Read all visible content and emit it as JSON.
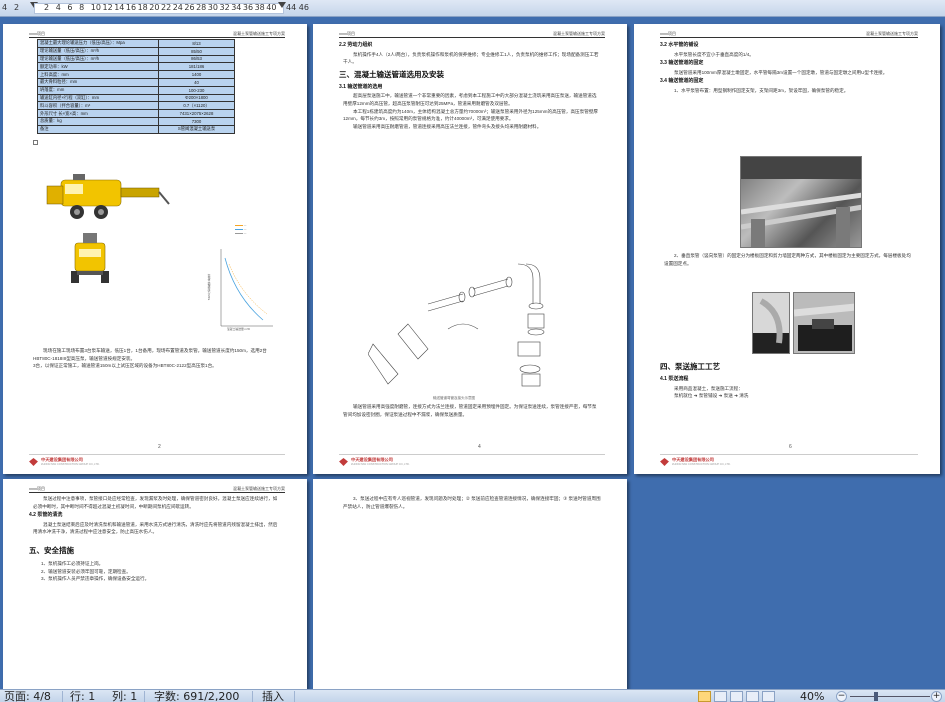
{
  "ruler": {
    "left_labels": [
      "4",
      "2"
    ],
    "labels": [
      "2",
      "4",
      "6",
      "8",
      "10",
      "12",
      "14",
      "16",
      "18",
      "20",
      "22",
      "24",
      "26",
      "28",
      "30",
      "32",
      "34",
      "36",
      "38",
      "40"
    ],
    "right_label": "44 46"
  },
  "doc": {
    "header_left": "xxxx项目",
    "header_right": "混凝土泵管输送施工专项方案",
    "company": "中天建设集团有限公司",
    "company_en": "ZHONGTIAN CONSTRUCTION GROUP CO.,LTD.",
    "pages": {
      "p2": {
        "number": "2",
        "table": [
          [
            "混凝土最大理论输送压力（低压/高压）：Mpa",
            "8/13"
          ],
          [
            "理论输送量（低压/高压）：m³/h",
            "85/50"
          ],
          [
            "理论输送量（低压/高压）：m³/h",
            "86/53"
          ],
          [
            "额定功率：kW",
            "181/186"
          ],
          [
            "上料高度：mm",
            "1400"
          ],
          [
            "最大骨料粒径：mm",
            "40"
          ],
          [
            "坍落度：mm",
            "100-230"
          ],
          [
            "输送缸内径×行程（双缸）：mm",
            "Φ200×1800"
          ],
          [
            "料斗容积（拌合容量）：m³",
            "0.7（×1120）"
          ],
          [
            "外形尺寸 长×宽×高：mm",
            "7431×2075×2628"
          ],
          [
            "总质量：kg",
            "7300"
          ],
          [
            "备注",
            "S管阀混凝土输送泵"
          ]
        ],
        "chart_labels": [
          "混凝土输送量 m³/h",
          "混凝土输送压力 MPa"
        ],
        "text": "现场在施工现场布置3台泵车输送，低压1台，1台备用，现场布置管道及泵管。输送管道长度约150m，选用2台HBT80C-1818III型高压泵，输送管道按规定安装。",
        "text2": "3台，以保证正常施工，输送管道150m以上试压区域的设备为HBT80C-2122型高压泵1台。"
      },
      "p4": {
        "number": "4",
        "s1_title": "2.2 劳动力组织",
        "s1_text": "泵机操作手4人（2人/两台），负责泵机操作和泵机的保养维修；专业维修工1人，负责泵机的维修工作；现场配备测压工若干人。",
        "s2_title": "三、混凝土输送管道选用及安装",
        "s3_title": "3.1 输送管道的选用",
        "s3_text": "超高层泵送施工中，输送管道一个非常重要的因素，考虑到本工程施工中的大部分混凝土浇筑采用高压泵送，输送管道选用壁厚12mm的高压管，超高压泵管耐压可达到25MPa，管道采用耐磨管及双层管。",
        "s3_text2": "本工程1栋建筑高度约为140m，主体结构混凝土总方量约70000m³；输送泵管采用外径为125mm的高压管，高压泵管壁厚12mm，每节长约3m，按照常用的泵管规格为准，约计40000m³，可满足使用要求。",
        "s3_text3": "输送管道采用高压耐磨管道，管道连接采用高压法兰连接，管件弯头及接头均采用耐磨材料。",
        "pipe_caption": "输送管道弯管及接头示意图",
        "s4_text": "输送管道采用高强度耐磨管，连接方式为法兰连接，管道固定采用预埋件固定。为保证泵送连续，泵管连接严密，每节泵管间均加设密封圈，保证泵送过程中不漏浆，确保泵送质量。"
      },
      "p6": {
        "number": "6",
        "s1_title": "3.2 水平管的铺设",
        "s1_text": "水平泵管长度不宜小于垂直高度的1/4。",
        "s2_title": "3.3 输送管道的固定",
        "s2_text": "泵送管道采用100mm厚混凝土墩固定，水平管每隔3m设置一个固定墩，管道与固定墩之间用U型卡连接。",
        "s3_title": "3.4 输送管道的固定",
        "s3_text": "1、水平泵管布置：用型钢制作固定支架，支架间距3m，架设牢固，确保泵管的稳定。",
        "s3_text2": "2、垂直泵管（竖向泵管）的固定分为楼板固定和剪力墙固定两种方式，其中楼板固定为主要固定方式，每层楼板处均设置固定点。",
        "s4_title": "四、泵送施工工艺",
        "s5_title": "4.1 泵送流程",
        "s5_text": "采用商品混凝土，泵送施工流程：",
        "flow": [
          "泵机就位",
          "泵管铺设",
          "泵送",
          "清洗"
        ]
      },
      "p7": {
        "p1": "泵送过程中注意事项，泵管接口处应经常检查，发现漏浆及时处理，确保管道密封良好。混凝土泵送应连续进行，如必须中断时，其中断时间不得超过混凝土初凝时间，中断期间泵机应间歇运转。",
        "s1_title": "4.2 泵管的清洗",
        "s1_text": "混凝土泵送结束后应及时清洗泵机和输送管道，采用水洗方式进行清洗，清洗时应先将管道内残留混凝土排出，然后用清水冲洗干净，清洗过程中应注意安全，防止高压水伤人。",
        "s2_title": "五、安全措施",
        "items": [
          "1、泵机操作工必须持证上岗。",
          "2、输送管道安装必须牢固可靠，定期检查。",
          "3、泵机操作人员严禁违章操作，确保设备安全运行。"
        ]
      },
      "p8": {
        "text": "3、泵送过程中应有专人巡视管道，发现问题及时处理；② 泵送前应检查管道连接情况，确保连接牢固；③ 泵送时管道周围严禁站人，防止管道爆裂伤人。"
      }
    }
  },
  "status": {
    "page": "页面: 4/8",
    "row": "行: 1",
    "col": "列: 1",
    "words": "字数: 691/2,200",
    "mode": "插入",
    "zoom": "40%",
    "minus": "−",
    "plus": "+"
  },
  "colors": {
    "workspace": "#3f6dae",
    "table_fill": "#b9d3ef",
    "pump_yellow": "#f2c400"
  }
}
